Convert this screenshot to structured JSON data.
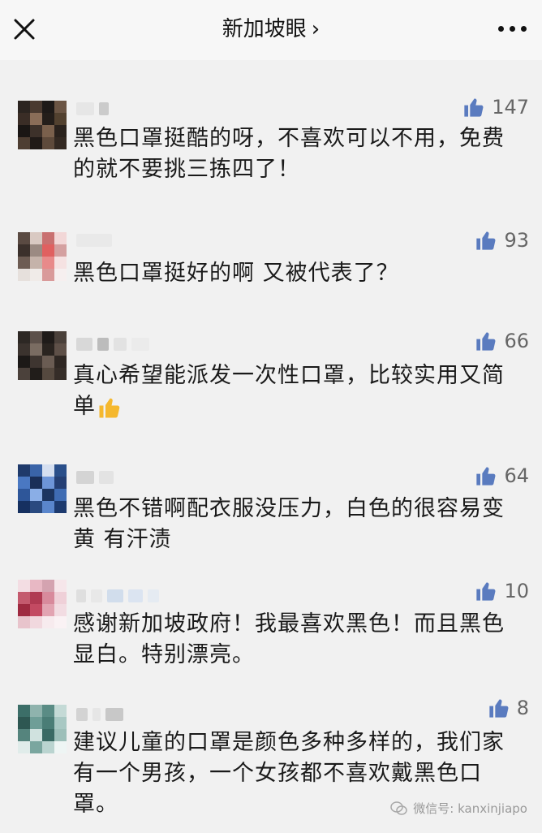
{
  "header": {
    "title": "新加坡眼",
    "chevron": "›",
    "close_icon": "close-icon",
    "more_icon": "more-icon"
  },
  "comments": [
    {
      "text": "黑色口罩挺酷的呀，不喜欢可以不用，免费的就不要挑三拣四了！",
      "likes": "147"
    },
    {
      "text": "黑色口罩挺好的啊 又被代表了？",
      "likes": "93"
    },
    {
      "text": "真心希望能派发一次性口罩，比较实用又简单",
      "likes": "66",
      "emoji": "thumbs-up-emoji"
    },
    {
      "text": "黑色不错啊配衣服没压力，白色的很容易变黄 有汗渍",
      "likes": "64"
    },
    {
      "text": "感谢新加坡政府！我最喜欢黑色！而且黑色显白。特别漂亮。",
      "likes": "10"
    },
    {
      "text": "建议儿童的口罩是颜色多种多样的，我们家有一个男孩，一个女孩都不喜欢戴黑色口罩。",
      "likes": "8"
    }
  ],
  "watermark": {
    "text": "微信号: kanxinjiapo"
  },
  "colors": {
    "like_icon": "#5a7bbf",
    "background": "#f1f1f1"
  }
}
